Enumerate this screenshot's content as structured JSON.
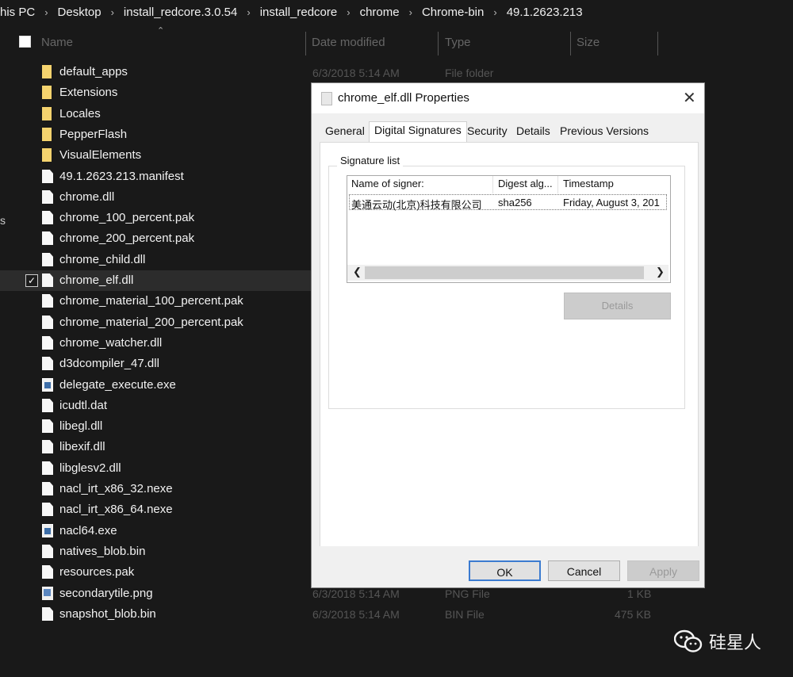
{
  "breadcrumb": [
    "his PC",
    "Desktop",
    "install_redcore.3.0.54",
    "install_redcore",
    "chrome",
    "Chrome-bin",
    "49.1.2623.213"
  ],
  "columns": {
    "name": "Name",
    "date": "Date modified",
    "type": "Type",
    "size": "Size"
  },
  "files": [
    {
      "name": "default_apps",
      "icon": "folder-icon"
    },
    {
      "name": "Extensions",
      "icon": "folder-icon"
    },
    {
      "name": "Locales",
      "icon": "folder-icon"
    },
    {
      "name": "PepperFlash",
      "icon": "folder-icon"
    },
    {
      "name": "VisualElements",
      "icon": "folder-icon"
    },
    {
      "name": "49.1.2623.213.manifest",
      "icon": "file-icon"
    },
    {
      "name": "chrome.dll",
      "icon": "file-icon"
    },
    {
      "name": "chrome_100_percent.pak",
      "icon": "file-icon"
    },
    {
      "name": "chrome_200_percent.pak",
      "icon": "file-icon"
    },
    {
      "name": "chrome_child.dll",
      "icon": "file-icon"
    },
    {
      "name": "chrome_elf.dll",
      "icon": "file-icon",
      "selected": true
    },
    {
      "name": "chrome_material_100_percent.pak",
      "icon": "file-icon"
    },
    {
      "name": "chrome_material_200_percent.pak",
      "icon": "file-icon"
    },
    {
      "name": "chrome_watcher.dll",
      "icon": "file-icon"
    },
    {
      "name": "d3dcompiler_47.dll",
      "icon": "file-icon"
    },
    {
      "name": "delegate_execute.exe",
      "icon": "exe-icon"
    },
    {
      "name": "icudtl.dat",
      "icon": "file-icon"
    },
    {
      "name": "libegl.dll",
      "icon": "file-icon"
    },
    {
      "name": "libexif.dll",
      "icon": "file-icon"
    },
    {
      "name": "libglesv2.dll",
      "icon": "file-icon"
    },
    {
      "name": "nacl_irt_x86_32.nexe",
      "icon": "file-icon"
    },
    {
      "name": "nacl_irt_x86_64.nexe",
      "icon": "file-icon"
    },
    {
      "name": "nacl64.exe",
      "icon": "exe-icon"
    },
    {
      "name": "natives_blob.bin",
      "icon": "file-icon"
    },
    {
      "name": "resources.pak",
      "icon": "file-icon"
    },
    {
      "name": "secondarytile.png",
      "icon": "png-icon"
    },
    {
      "name": "snapshot_blob.bin",
      "icon": "file-icon"
    }
  ],
  "visible_details": [
    {
      "date": "6/3/2018 5:14 AM",
      "type": "File folder",
      "size": ""
    },
    {
      "date": "6/3/2018 5:14 AM",
      "type": "PNG File",
      "size": "1 KB"
    },
    {
      "date": "6/3/2018 5:14 AM",
      "type": "BIN File",
      "size": "475 KB"
    }
  ],
  "dialog": {
    "title": "chrome_elf.dll Properties",
    "tabs": [
      "General",
      "Digital Signatures",
      "Security",
      "Details",
      "Previous Versions"
    ],
    "active_tab": "Digital Signatures",
    "signature_list_label": "Signature list",
    "list_headers": [
      "Name of signer:",
      "Digest alg...",
      "Timestamp"
    ],
    "signers": [
      {
        "name": "美通云动(北京)科技有限公司",
        "digest": "sha256",
        "timestamp": "Friday, August 3, 201"
      }
    ],
    "details_button": "Details",
    "ok": "OK",
    "cancel": "Cancel",
    "apply": "Apply"
  },
  "watermark": "硅星人",
  "left_edge_text": "s"
}
